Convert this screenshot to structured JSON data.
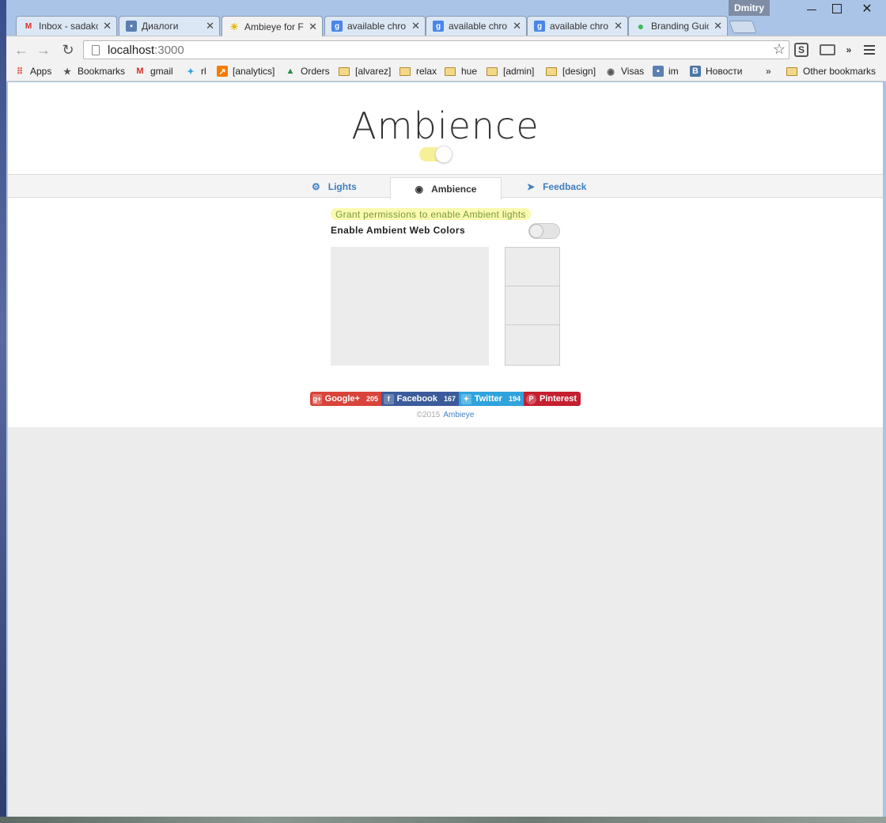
{
  "browser": {
    "profile_name": "Dmitry",
    "tabs": [
      {
        "title": "Inbox - sadako",
        "icon": "gmail-icon",
        "color": "#d93025",
        "glyph": "M"
      },
      {
        "title": "Диалоги",
        "icon": "dialog-icon",
        "color": "#5b7fb0",
        "glyph": "▪"
      },
      {
        "title": "Ambieye for F",
        "icon": "bulb-icon",
        "color": "#f3d23a",
        "glyph": "💡"
      },
      {
        "title": "available chro",
        "icon": "google-icon",
        "color": "#4a86e8",
        "glyph": "g"
      },
      {
        "title": "available chro",
        "icon": "google-icon",
        "color": "#4a86e8",
        "glyph": "g"
      },
      {
        "title": "available chro",
        "icon": "google-icon",
        "color": "#4a86e8",
        "glyph": "g"
      },
      {
        "title": "Branding Guic",
        "icon": "chrome-icon",
        "color": "#3cba54",
        "glyph": "●"
      }
    ],
    "url_host": "localhost",
    "url_port": ":3000",
    "bookmarks": [
      {
        "label": "Apps",
        "icon": "apps-icon"
      },
      {
        "label": "Bookmarks",
        "icon": "star-icon"
      },
      {
        "label": "gmail",
        "icon": "gmail-icon"
      },
      {
        "label": "rl",
        "icon": "twitter-icon"
      },
      {
        "label": "[analytics]",
        "icon": "analytics-icon"
      },
      {
        "label": "Orders",
        "icon": "drive-icon"
      },
      {
        "label": "[alvarez]",
        "icon": "folder-icon"
      },
      {
        "label": "relax",
        "icon": "folder-icon"
      },
      {
        "label": "hue",
        "icon": "folder-icon"
      },
      {
        "label": "[admin]",
        "icon": "folder-icon"
      },
      {
        "label": "[design]",
        "icon": "folder-icon"
      },
      {
        "label": "Visas",
        "icon": "seal-icon"
      },
      {
        "label": "im",
        "icon": "dialog-icon"
      },
      {
        "label": "Новости",
        "icon": "vk-icon"
      }
    ],
    "bookmarks_overflow": "»",
    "other_bookmarks": "Other bookmarks"
  },
  "app": {
    "brand": "Ambience",
    "master_toggle_on": true,
    "tabs": {
      "lights": "Lights",
      "ambience": "Ambience",
      "feedback": "Feedback"
    },
    "active_tab": "Ambience",
    "permission_notice": "Grant permissions to enable Ambient lights",
    "enable_label": "Enable Ambient Web Colors",
    "web_colors_toggle_on": false,
    "share": {
      "gplus": {
        "label": "Google+",
        "count": "205"
      },
      "facebook": {
        "label": "Facebook",
        "count": "167"
      },
      "twitter": {
        "label": "Twitter",
        "count": "194"
      },
      "pinterest": {
        "label": "Pinterest"
      }
    },
    "footer_year": "©2015",
    "footer_link": "Ambieye"
  },
  "colors": {
    "accent": "#3f7fc0",
    "toggle_on": "#f6f199",
    "highlight": "#fafab0"
  }
}
